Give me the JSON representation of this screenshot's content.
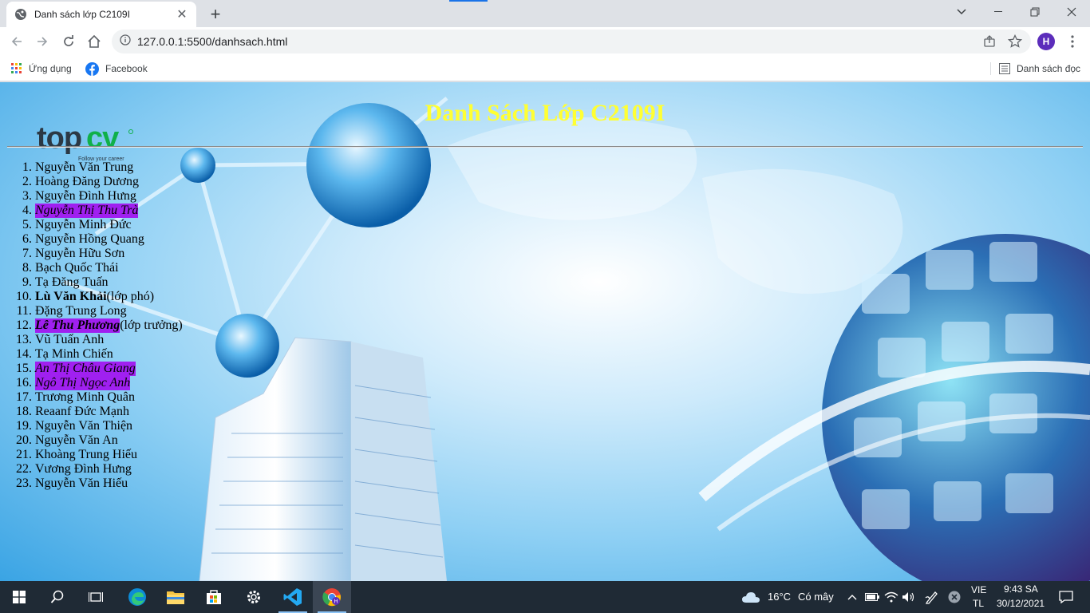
{
  "browser": {
    "tab_title": "Danh sách lớp C2109I",
    "url": "127.0.0.1:5500/danhsach.html",
    "profile_initial": "H",
    "bookmarks": [
      {
        "label": "Ứng dụng",
        "icon": "apps-grid-icon"
      },
      {
        "label": "Facebook",
        "icon": "facebook-icon"
      }
    ],
    "reading_list": "Danh sách đọc"
  },
  "page": {
    "title": "Danh Sách Lớp C2109I",
    "logo_text": "topcv",
    "logo_tagline": "Follow your career",
    "students": [
      {
        "num": "1.",
        "name": "Nguyễn Văn Trung",
        "suffix": "",
        "highlight": false,
        "bold": false
      },
      {
        "num": "2.",
        "name": "Hoàng Đăng Dương",
        "suffix": "",
        "highlight": false,
        "bold": false
      },
      {
        "num": "3.",
        "name": "Nguyễn Đình Hưng",
        "suffix": "",
        "highlight": false,
        "bold": false
      },
      {
        "num": "4.",
        "name": "Nguyễn Thị Thu Trà",
        "suffix": "",
        "highlight": true,
        "bold": false
      },
      {
        "num": "5.",
        "name": "Nguyễn Minh Đức",
        "suffix": "",
        "highlight": false,
        "bold": false
      },
      {
        "num": "6.",
        "name": "Nguyễn Hồng Quang",
        "suffix": "",
        "highlight": false,
        "bold": false
      },
      {
        "num": "7.",
        "name": "Nguyễn Hữu Sơn",
        "suffix": "",
        "highlight": false,
        "bold": false
      },
      {
        "num": "8.",
        "name": "Bạch Quốc Thái",
        "suffix": "",
        "highlight": false,
        "bold": false
      },
      {
        "num": "9.",
        "name": "Tạ Đăng Tuấn",
        "suffix": "",
        "highlight": false,
        "bold": false
      },
      {
        "num": "10.",
        "name": "Lù Văn Khải",
        "suffix": "(lớp phó)",
        "highlight": false,
        "bold": true
      },
      {
        "num": "11.",
        "name": "Đặng Trung Long",
        "suffix": "",
        "highlight": false,
        "bold": false
      },
      {
        "num": "12.",
        "name": "Lê Thu Phương",
        "suffix": "(lớp trưởng)",
        "highlight": true,
        "bold": true
      },
      {
        "num": "13.",
        "name": "Vũ Tuấn Anh",
        "suffix": "",
        "highlight": false,
        "bold": false
      },
      {
        "num": "14.",
        "name": "Tạ Minh Chiến",
        "suffix": "",
        "highlight": false,
        "bold": false
      },
      {
        "num": "15.",
        "name": "An Thị Châu Giang",
        "suffix": "",
        "highlight": true,
        "bold": false
      },
      {
        "num": "16.",
        "name": "Ngô Thị Ngọc Anh",
        "suffix": "",
        "highlight": true,
        "bold": false
      },
      {
        "num": "17.",
        "name": "Trương Minh Quân",
        "suffix": "",
        "highlight": false,
        "bold": false
      },
      {
        "num": "18.",
        "name": "Reaanf Đức Mạnh",
        "suffix": "",
        "highlight": false,
        "bold": false
      },
      {
        "num": "19.",
        "name": "Nguyễn Văn Thiện",
        "suffix": "",
        "highlight": false,
        "bold": false
      },
      {
        "num": "20.",
        "name": "Nguyễn Văn An",
        "suffix": "",
        "highlight": false,
        "bold": false
      },
      {
        "num": "21.",
        "name": "Khoàng Trung Hiếu",
        "suffix": "",
        "highlight": false,
        "bold": false
      },
      {
        "num": "22.",
        "name": "Vương Đình Hưng",
        "suffix": "",
        "highlight": false,
        "bold": false
      },
      {
        "num": "23.",
        "name": "Nguyễn Văn Hiếu",
        "suffix": "",
        "highlight": false,
        "bold": false
      }
    ]
  },
  "taskbar": {
    "weather_temp": "16°C",
    "weather_desc": "Có mây",
    "lang_1": "VIE",
    "lang_2": "TL",
    "time": "9:43 SA",
    "date": "30/12/2021",
    "apps": [
      "start-icon",
      "search-icon",
      "task-view-icon",
      "edge-icon",
      "file-explorer-icon",
      "store-icon",
      "settings-icon",
      "vscode-icon",
      "chrome-icon"
    ]
  },
  "colors": {
    "title_yellow": "#ffff33",
    "highlight_purple": "#a020f0",
    "profile_purple": "#5c2dbb",
    "taskbar_bg": "#1f2a35"
  }
}
